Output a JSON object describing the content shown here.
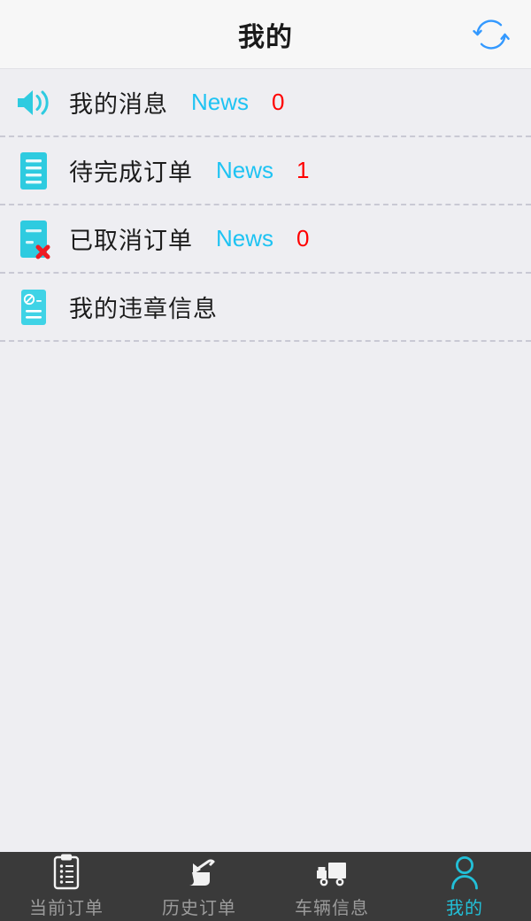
{
  "header": {
    "title": "我的",
    "refresh_icon": "refresh-circle-icon"
  },
  "colors": {
    "page_background": "#eeeef2",
    "header_background": "#f7f7f7",
    "icon_cyan": "#2ecbe0",
    "icon_cyan_light": "#3fd3e6",
    "news_blue": "#1ec3f3",
    "count_red": "#ff0000",
    "refresh_blue": "#3399ff",
    "tabbar_background": "#3a3a3a",
    "tab_inactive": "#9b9b9b",
    "tab_active": "#22c0d8",
    "divider": "#c9c9d4"
  },
  "list": {
    "rows": [
      {
        "icon": "speaker-announcement-icon",
        "label": "我的消息",
        "news": "News",
        "count": "0"
      },
      {
        "icon": "pending-order-document-icon",
        "label": "待完成订单",
        "news": "News",
        "count": "1"
      },
      {
        "icon": "cancelled-order-icon",
        "label": "已取消订单",
        "news": "News",
        "count": "0"
      },
      {
        "icon": "violation-document-icon",
        "label": "我的违章信息",
        "news": "",
        "count": ""
      }
    ]
  },
  "tabbar": {
    "tabs": [
      {
        "icon": "clipboard-icon",
        "label": "当前订单",
        "active": false
      },
      {
        "icon": "scroll-history-icon",
        "label": "历史订单",
        "active": false
      },
      {
        "icon": "truck-icon",
        "label": "车辆信息",
        "active": false
      },
      {
        "icon": "person-icon",
        "label": "我的",
        "active": true
      }
    ]
  }
}
